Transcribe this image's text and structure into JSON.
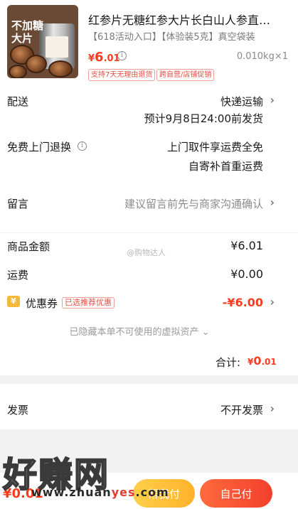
{
  "product": {
    "image_tag": "不加糖 大片",
    "title": "红参片无糖红参大片长白山人参直参…",
    "spec": "【618活动入口】【体验装5克】真空袋装",
    "price_currency": "¥",
    "price_int": "6",
    "price_dec": ".01",
    "weight_qty": "0.010kg×1",
    "badges": [
      "支持7天无理由退货",
      "跨自营/店铺促销"
    ]
  },
  "shipping": {
    "label": "配送",
    "method": "快递运输",
    "eta": "预计9月8日24:00前发货"
  },
  "return_service": {
    "label": "免费上门退换",
    "line1": "上门取件享运费全免",
    "line2": "自寄补首重运费"
  },
  "message": {
    "label": "留言",
    "placeholder": "建议留言前先与商家沟通确认"
  },
  "amounts": {
    "goods_label": "商品金额",
    "goods_value": "¥6.01",
    "freight_label": "运费",
    "freight_value": "¥0.00",
    "coupon_label": "优惠券",
    "coupon_icon": "¥",
    "coupon_tag": "已选推荐优惠",
    "coupon_value": "-¥6.00",
    "hidden_note": "已隐藏本单不可使用的虚拟资产",
    "total_label": "合计:",
    "total_currency": "¥",
    "total_int": "0",
    "total_dec": ".01"
  },
  "invoice": {
    "label": "发票",
    "value": "不开发票"
  },
  "watermark_text": "@购物达人",
  "bottom": {
    "price": "¥0.01",
    "help_pay": "帮我付",
    "self_pay": "自己付"
  },
  "overlay_watermark": {
    "big": "好赚网",
    "site_prefix": "www.zhuan",
    "site_accent": "yes",
    "site_suffix": ".com"
  },
  "colors": {
    "accent": "#ff3b1f",
    "help_button": "#ffb22b",
    "self_button": "#f2402c"
  }
}
